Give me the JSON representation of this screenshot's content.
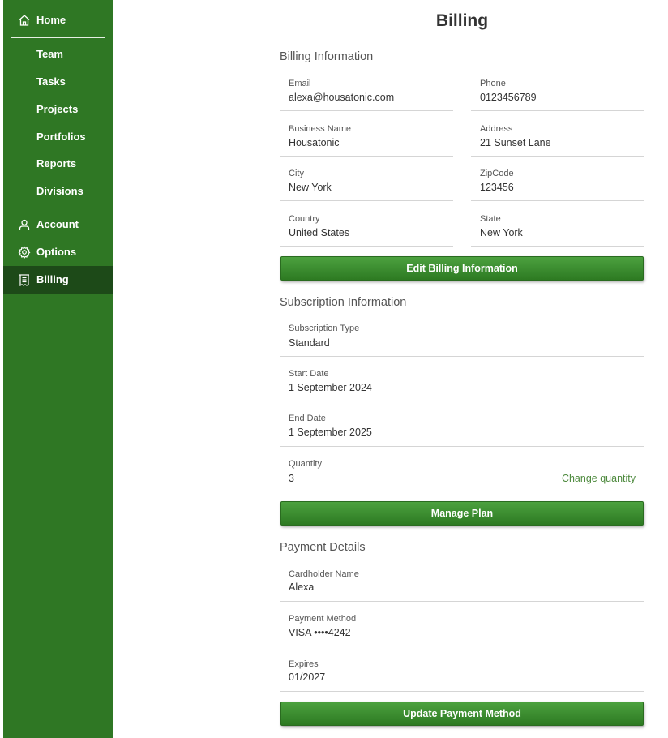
{
  "sidebar": {
    "items": [
      {
        "label": "Home",
        "icon": "home-icon"
      },
      {
        "label": "Team"
      },
      {
        "label": "Tasks"
      },
      {
        "label": "Projects"
      },
      {
        "label": "Portfolios"
      },
      {
        "label": "Reports"
      },
      {
        "label": "Divisions"
      },
      {
        "label": "Account",
        "icon": "user-icon"
      },
      {
        "label": "Options",
        "icon": "gear-icon"
      },
      {
        "label": "Billing",
        "icon": "receipt-icon",
        "active": true
      }
    ]
  },
  "page": {
    "title": "Billing"
  },
  "billing_info": {
    "title": "Billing Information",
    "email": {
      "label": "Email",
      "value": "alexa@housatonic.com"
    },
    "phone": {
      "label": "Phone",
      "value": "0123456789"
    },
    "business_name": {
      "label": "Business Name",
      "value": "Housatonic"
    },
    "address": {
      "label": "Address",
      "value": "21 Sunset Lane"
    },
    "city": {
      "label": "City",
      "value": "New York"
    },
    "zipcode": {
      "label": "ZipCode",
      "value": "123456"
    },
    "country": {
      "label": "Country",
      "value": "United States"
    },
    "state": {
      "label": "State",
      "value": "New York"
    },
    "edit_button": "Edit Billing Information"
  },
  "subscription": {
    "title": "Subscription Information",
    "type": {
      "label": "Subscription Type",
      "value": "Standard"
    },
    "start_date": {
      "label": "Start Date",
      "value": "1 September 2024"
    },
    "end_date": {
      "label": "End Date",
      "value": "1 September 2025"
    },
    "quantity": {
      "label": "Quantity",
      "value": "3",
      "link": "Change quantity"
    },
    "manage_button": "Manage Plan"
  },
  "payment": {
    "title": "Payment Details",
    "cardholder": {
      "label": "Cardholder Name",
      "value": "Alexa"
    },
    "method": {
      "label": "Payment Method",
      "value": "VISA ••••4242"
    },
    "expires": {
      "label": "Expires",
      "value": "01/2027"
    },
    "update_button": "Update Payment Method"
  },
  "colors": {
    "sidebar_bg": "#2f7724",
    "sidebar_active": "#1d4a18",
    "button_green": "#3c8f30",
    "link_green": "#4e8a3e"
  }
}
